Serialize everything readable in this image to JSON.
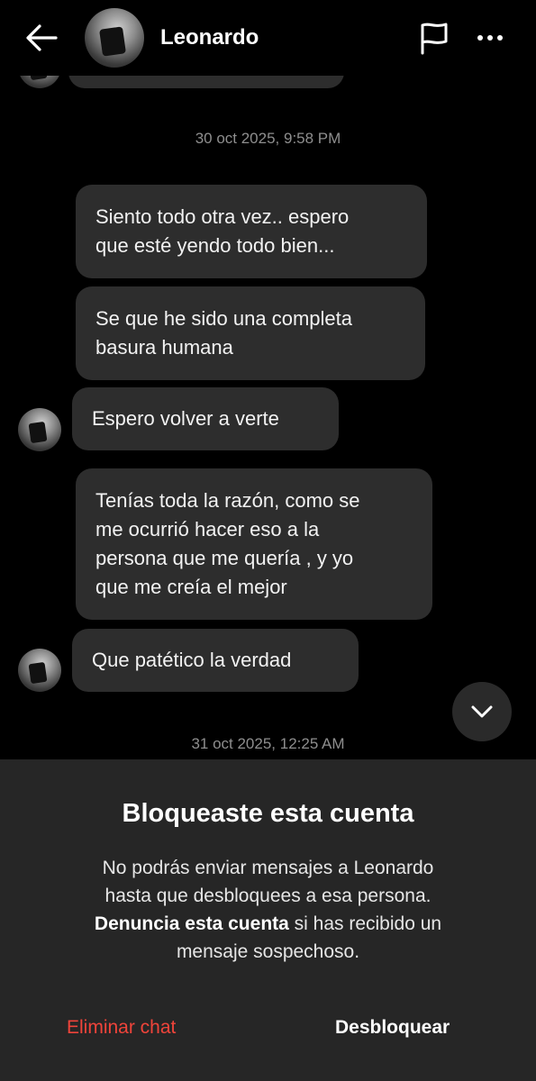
{
  "header": {
    "name": "Leonardo"
  },
  "chat": {
    "timestamps": [
      "30 oct 2025, 9:58 PM",
      "31 oct 2025, 12:25 AM"
    ],
    "messages": [
      {
        "line1": "Siento todo otra vez.. espero",
        "line2": "que esté yendo todo bien..."
      },
      {
        "line1": "Se que he sido una completa",
        "line2": "basura humana"
      },
      {
        "line1": "Espero volver a verte"
      },
      {
        "line1": "Tenías toda la razón, como se",
        "line2": "me ocurrió hacer eso a la",
        "line3": "persona que me quería , y yo",
        "line4": "que me creía el mejor"
      },
      {
        "line1": "Que patético la verdad"
      }
    ]
  },
  "blocked": {
    "title": "Bloqueaste esta cuenta",
    "line1": "No podrás enviar mensajes a Leonardo",
    "line2": "hasta que desbloquees a esa persona.",
    "report_link": "Denuncia esta cuenta",
    "line3_rest": " si has recibido un",
    "line4": "mensaje sospechoso.",
    "delete_label": "Eliminar chat",
    "unblock_label": "Desbloquear",
    "delete_color": "#f0443a"
  },
  "icons": [
    "back-arrow-icon",
    "flag-icon",
    "more-icon",
    "chevron-down-icon"
  ]
}
